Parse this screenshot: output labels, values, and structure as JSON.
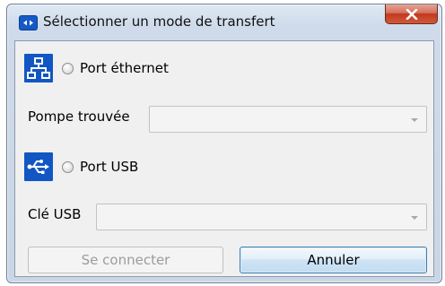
{
  "window": {
    "title": "Sélectionner un mode de transfert"
  },
  "ethernet": {
    "icon": "network-icon",
    "radio_label": "Port éthernet",
    "selected": false,
    "pump_label": "Pompe trouvée",
    "pump_value": ""
  },
  "usb": {
    "icon": "usb-icon",
    "radio_label": "Port USB",
    "selected": false,
    "key_label": "Clé USB",
    "key_value": ""
  },
  "buttons": {
    "connect_label": "Se connecter",
    "connect_enabled": false,
    "cancel_label": "Annuler"
  },
  "colors": {
    "icon_blue": "#1256c4",
    "close_red": "#c2391c"
  }
}
